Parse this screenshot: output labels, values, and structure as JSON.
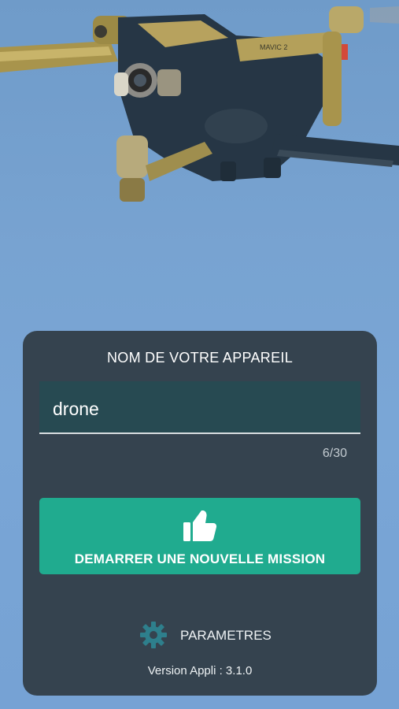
{
  "hero": {
    "image": "drone-photo",
    "accent": "#b8a35a"
  },
  "form": {
    "title": "NOM DE VOTRE APPAREIL",
    "device_name_value": "drone",
    "char_counter": "6/30"
  },
  "actions": {
    "mission_icon": "thumbs-up-icon",
    "mission_label": "DEMARRER UNE NOUVELLE MISSION",
    "settings_icon": "gear-icon",
    "settings_label": "PARAMETRES"
  },
  "footer": {
    "version": "Version Appli : 3.1.0"
  },
  "colors": {
    "card": "#35434f",
    "field": "#274a52",
    "button": "#20ab8f",
    "gear": "#2e7f8c"
  }
}
